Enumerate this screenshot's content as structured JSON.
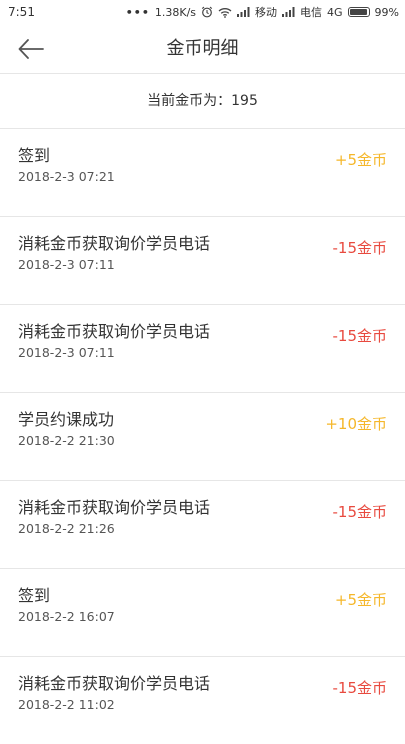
{
  "status_bar": {
    "time": "7:51",
    "dots": "•••",
    "speed": "1.38K/s",
    "carrier1": "移动",
    "carrier2": "电信",
    "network": "4G",
    "battery": "99%",
    "battery_level": 0.99,
    "icons": [
      "alarm-icon",
      "wifi-icon",
      "signal-icon",
      "signal-icon",
      "battery-icon"
    ]
  },
  "header": {
    "back_icon": "back-arrow-icon",
    "title": "金币明细"
  },
  "balance": {
    "label": "当前金币为：195"
  },
  "colors": {
    "positive": "#f5b72a",
    "negative": "#e84a3f"
  },
  "records": [
    {
      "title": "签到",
      "time": "2018-2-3 07:21",
      "amount": "+5金币",
      "type": "positive"
    },
    {
      "title": "消耗金币获取询价学员电话",
      "time": "2018-2-3 07:11",
      "amount": "-15金币",
      "type": "negative"
    },
    {
      "title": "消耗金币获取询价学员电话",
      "time": "2018-2-3 07:11",
      "amount": "-15金币",
      "type": "negative"
    },
    {
      "title": "学员约课成功",
      "time": "2018-2-2 21:30",
      "amount": "+10金币",
      "type": "positive"
    },
    {
      "title": "消耗金币获取询价学员电话",
      "time": "2018-2-2 21:26",
      "amount": "-15金币",
      "type": "negative"
    },
    {
      "title": "签到",
      "time": "2018-2-2 16:07",
      "amount": "+5金币",
      "type": "positive"
    },
    {
      "title": "消耗金币获取询价学员电话",
      "time": "2018-2-2 11:02",
      "amount": "-15金币",
      "type": "negative"
    }
  ]
}
